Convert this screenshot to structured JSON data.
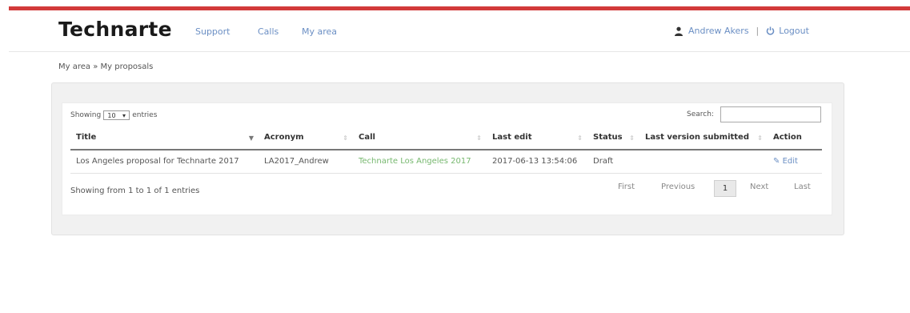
{
  "header": {
    "brand": "Technarte",
    "nav": [
      "Support",
      "Calls",
      "My area"
    ],
    "user_name": "Andrew Akers",
    "separator": "|",
    "logout_label": "Logout"
  },
  "breadcrumb": "My area » My proposals",
  "table_controls": {
    "showing_prefix": "Showing",
    "page_length": "10",
    "showing_suffix": "entries",
    "search_label": "Search:",
    "search_value": ""
  },
  "table": {
    "columns": [
      "Title",
      "Acronym",
      "Call",
      "Last edit",
      "Status",
      "Last version submitted",
      "Action"
    ],
    "rows": [
      {
        "title": "Los Angeles proposal for Technarte 2017",
        "acronym": "LA2017_Andrew",
        "call": "Technarte Los Angeles 2017",
        "last_edit": "2017-06-13 13:54:06",
        "status": "Draft",
        "last_version_submitted": "",
        "action": "Edit"
      }
    ]
  },
  "footer": {
    "info": "Showing from 1 to 1 of 1 entries",
    "first": "First",
    "previous": "Previous",
    "current_page": "1",
    "next": "Next",
    "last": "Last"
  },
  "colors": {
    "accent_bar": "#d23a3a",
    "link": "#6b8fc4",
    "call_link": "#77b86f"
  },
  "icons": {
    "user": "user-icon",
    "logout": "power-icon",
    "edit": "edit-icon",
    "dropdown": "caret-down-icon"
  }
}
